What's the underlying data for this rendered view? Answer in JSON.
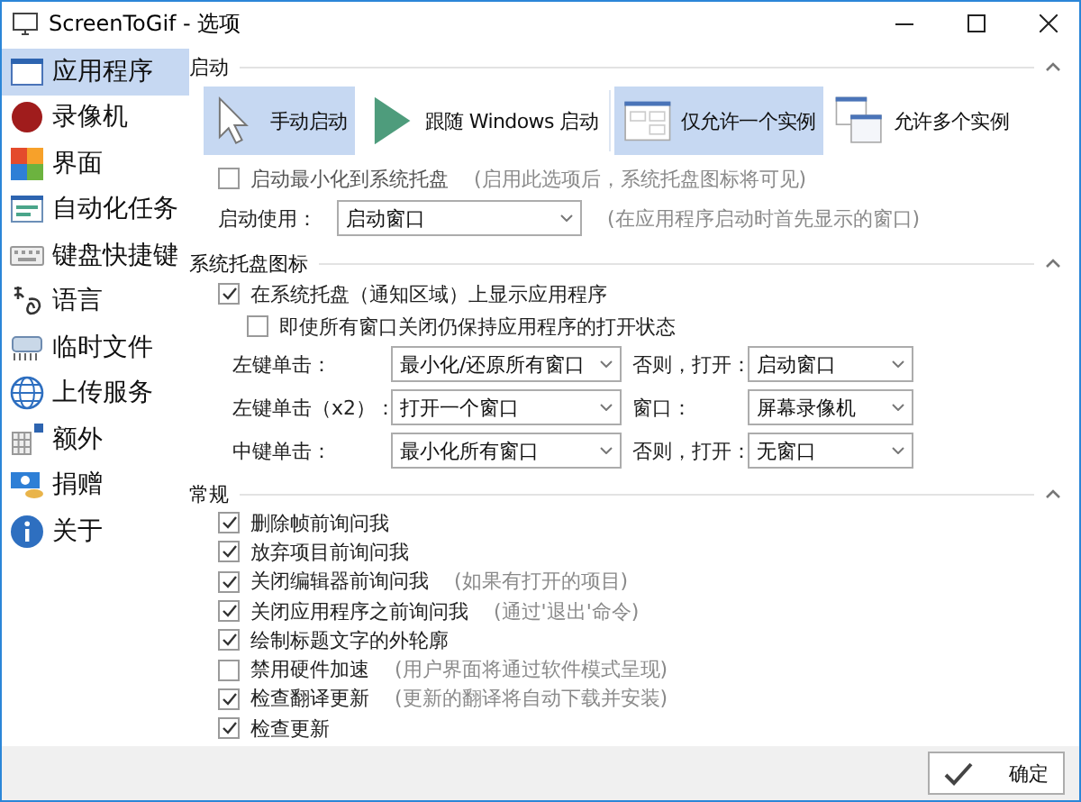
{
  "window": {
    "title": "ScreenToGif - 选项"
  },
  "sidebar": {
    "items": [
      {
        "label": "应用程序",
        "selected": true
      },
      {
        "label": "录像机",
        "selected": false
      },
      {
        "label": "界面",
        "selected": false
      },
      {
        "label": "自动化任务",
        "selected": false
      },
      {
        "label": "键盘快捷键",
        "selected": false
      },
      {
        "label": "语言",
        "selected": false
      },
      {
        "label": "临时文件",
        "selected": false
      },
      {
        "label": "上传服务",
        "selected": false
      },
      {
        "label": "额外",
        "selected": false
      },
      {
        "label": "捐赠",
        "selected": false
      },
      {
        "label": "关于",
        "selected": false
      }
    ]
  },
  "startup": {
    "title": "启动",
    "launch_options": [
      {
        "label": "手动启动",
        "selected": true
      },
      {
        "label": "跟随 Windows 启动",
        "selected": false
      }
    ],
    "instance_options": [
      {
        "label": "仅允许一个实例",
        "selected": true
      },
      {
        "label": "允许多个实例",
        "selected": false
      }
    ],
    "minimize": {
      "label": "启动最小化到系统托盘",
      "hint": "(启用此选项后，系统托盘图标将可见)",
      "checked": false
    },
    "start_with": {
      "label": "启动使用：",
      "value": "启动窗口",
      "hint": "(在应用程序启动时首先显示的窗口)"
    }
  },
  "tray": {
    "title": "系统托盘图标",
    "show": {
      "label": "在系统托盘（通知区域）上显示应用程序",
      "checked": true
    },
    "keep": {
      "label": "即使所有窗口关闭仍保持应用程序的打开状态",
      "checked": false
    },
    "rows": [
      {
        "label": "左键单击：",
        "value": "最小化/还原所有窗口",
        "label_2": "否则，打开：",
        "value_2": "启动窗口"
      },
      {
        "label": "左键单击（x2）：",
        "value": "打开一个窗口",
        "label_2": "窗口：",
        "value_2": "屏幕录像机"
      },
      {
        "label": "中键单击：",
        "value": "最小化所有窗口",
        "label_2": "否则，打开：",
        "value_2": "无窗口"
      }
    ]
  },
  "general": {
    "title": "常规",
    "options": [
      {
        "label": "删除帧前询问我",
        "checked": true
      },
      {
        "label": "放弃项目前询问我",
        "checked": true
      },
      {
        "label": "关闭编辑器前询问我",
        "hint": "(如果有打开的项目)",
        "checked": true
      },
      {
        "label": "关闭应用程序之前询问我",
        "hint": "(通过'退出'命令)",
        "checked": true
      },
      {
        "label": "绘制标题文字的外轮廓",
        "checked": true
      },
      {
        "label": "禁用硬件加速",
        "hint": "(用户界面将通过软件模式呈现)",
        "checked": false
      },
      {
        "label": "检查翻译更新",
        "hint": "(更新的翻译将自动下载并安装)",
        "checked": true
      },
      {
        "label": "检查更新",
        "checked": true
      }
    ]
  },
  "footer": {
    "ok_button": "确定"
  }
}
